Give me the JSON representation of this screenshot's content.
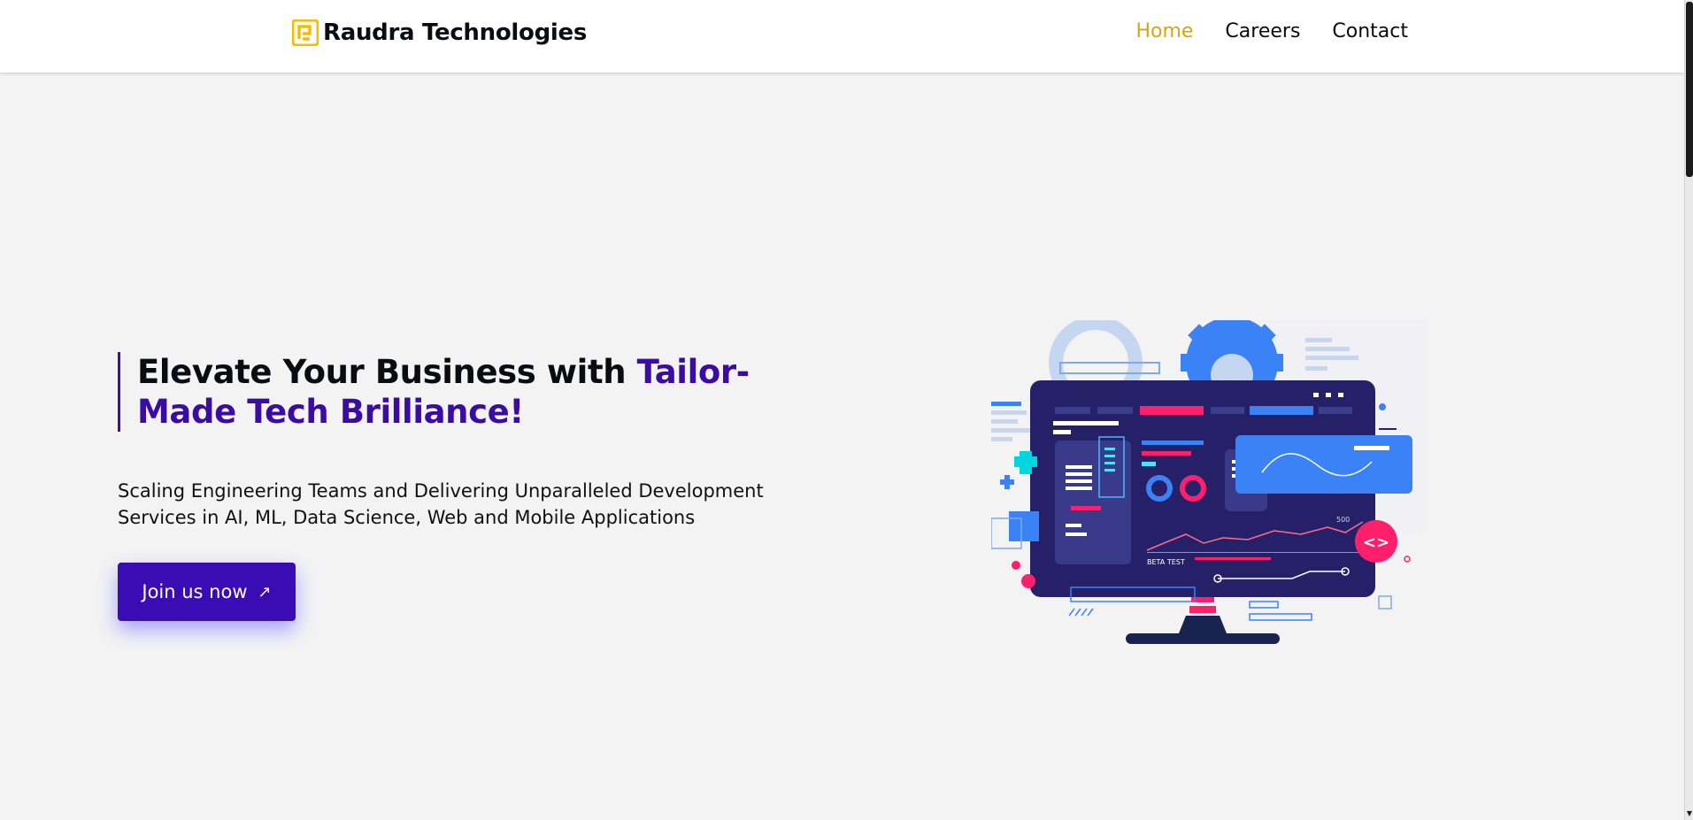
{
  "header": {
    "brand_name": "Raudra Technologies",
    "logo_icon": "raudra-logo-icon",
    "nav": [
      {
        "label": "Home",
        "active": true
      },
      {
        "label": "Careers",
        "active": false
      },
      {
        "label": "Contact",
        "active": false
      }
    ]
  },
  "hero": {
    "headline_plain": "Elevate Your Business with ",
    "headline_accent": "Tailor-Made Tech Brilliance!",
    "subtitle": "Scaling Engineering Teams and Delivering Unparalleled Development Services in AI, ML, Data Science, Web and Mobile Applications",
    "cta_label": "Join us now",
    "cta_icon": "arrow-up-right-icon",
    "illustration": {
      "icon": "computer-dashboard-illustration",
      "beta_label": "BETA TEST",
      "value_label": "500",
      "code_badge": "<>"
    }
  },
  "colors": {
    "accent_purple": "#3a0ca3",
    "nav_active": "#d4a80f",
    "background": "#f3f3f4",
    "monitor": "#262068"
  }
}
